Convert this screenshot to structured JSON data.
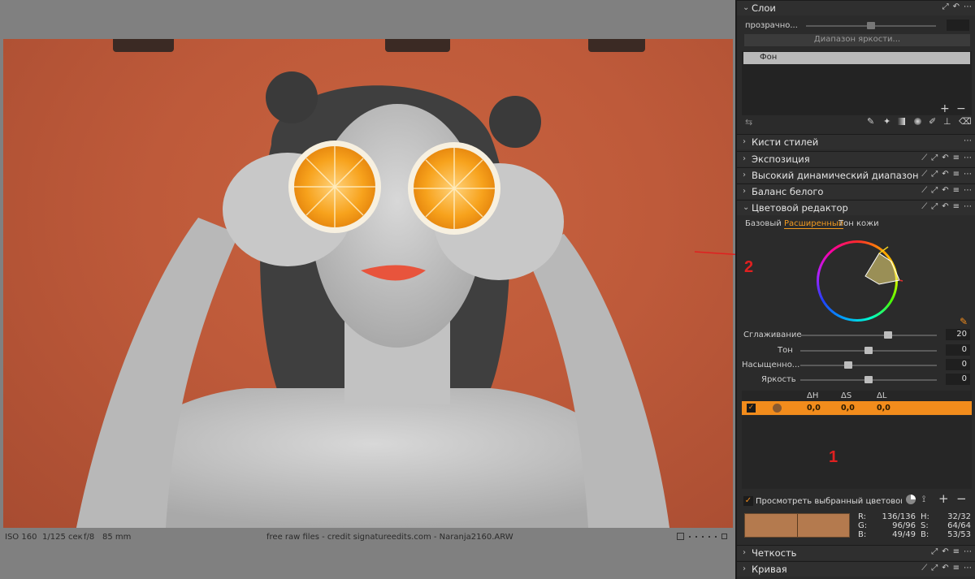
{
  "viewer": {
    "status": {
      "iso": "ISO 160",
      "shutter": "1/125 сек",
      "aperture": "f/8",
      "focal": "85 mm",
      "caption": "free raw files - credit signatureedits.com - Naranja2160.ARW"
    }
  },
  "layers": {
    "title": "Слои",
    "opacity_label": "прозрачно...",
    "opacity_value": "",
    "luma_button": "Диапазон яркости...",
    "layer_name": "Фон"
  },
  "sections": {
    "styles": "Кисти стилей",
    "exposure": "Экспозиция",
    "hdr": "Высокий динамический диапазон",
    "wb": "Баланс белого",
    "color_editor": "Цветовой редактор",
    "clarity": "Четкость",
    "curve": "Кривая"
  },
  "color_editor": {
    "tabs": [
      "Базовый",
      "Расширенный",
      "Тон кожи"
    ],
    "active_tab": 1,
    "sliders": [
      {
        "label": "Сглаживание",
        "value": "20",
        "pos": 0.65
      },
      {
        "label": "Тон",
        "value": "0",
        "pos": 0.5
      },
      {
        "label": "Насыщенно...",
        "value": "0",
        "pos": 0.34
      },
      {
        "label": "Яркость",
        "value": "0",
        "pos": 0.5
      }
    ],
    "table": {
      "headers": [
        "ΔH",
        "ΔS",
        "ΔL"
      ],
      "row": {
        "dh": "0,0",
        "ds": "0,0",
        "dl": "0,0"
      }
    },
    "view_selected_label": "Просмотреть выбранный цветовой диа...",
    "readout": {
      "r_label": "R:",
      "r_value": "136/136",
      "g_label": "G:",
      "g_value": "96/96",
      "b_label": "B:",
      "b_value": "49/49",
      "h_label": "H:",
      "h_value": "32/32",
      "s_label": "S:",
      "s_value": "64/64",
      "b2_label": "B:",
      "b2_value": "53/53"
    }
  },
  "annotations": {
    "one": "1",
    "two": "2"
  },
  "colors": {
    "accent": "#f28c1c",
    "arrow": "#e02020",
    "backdrop": "#be5a3a"
  }
}
